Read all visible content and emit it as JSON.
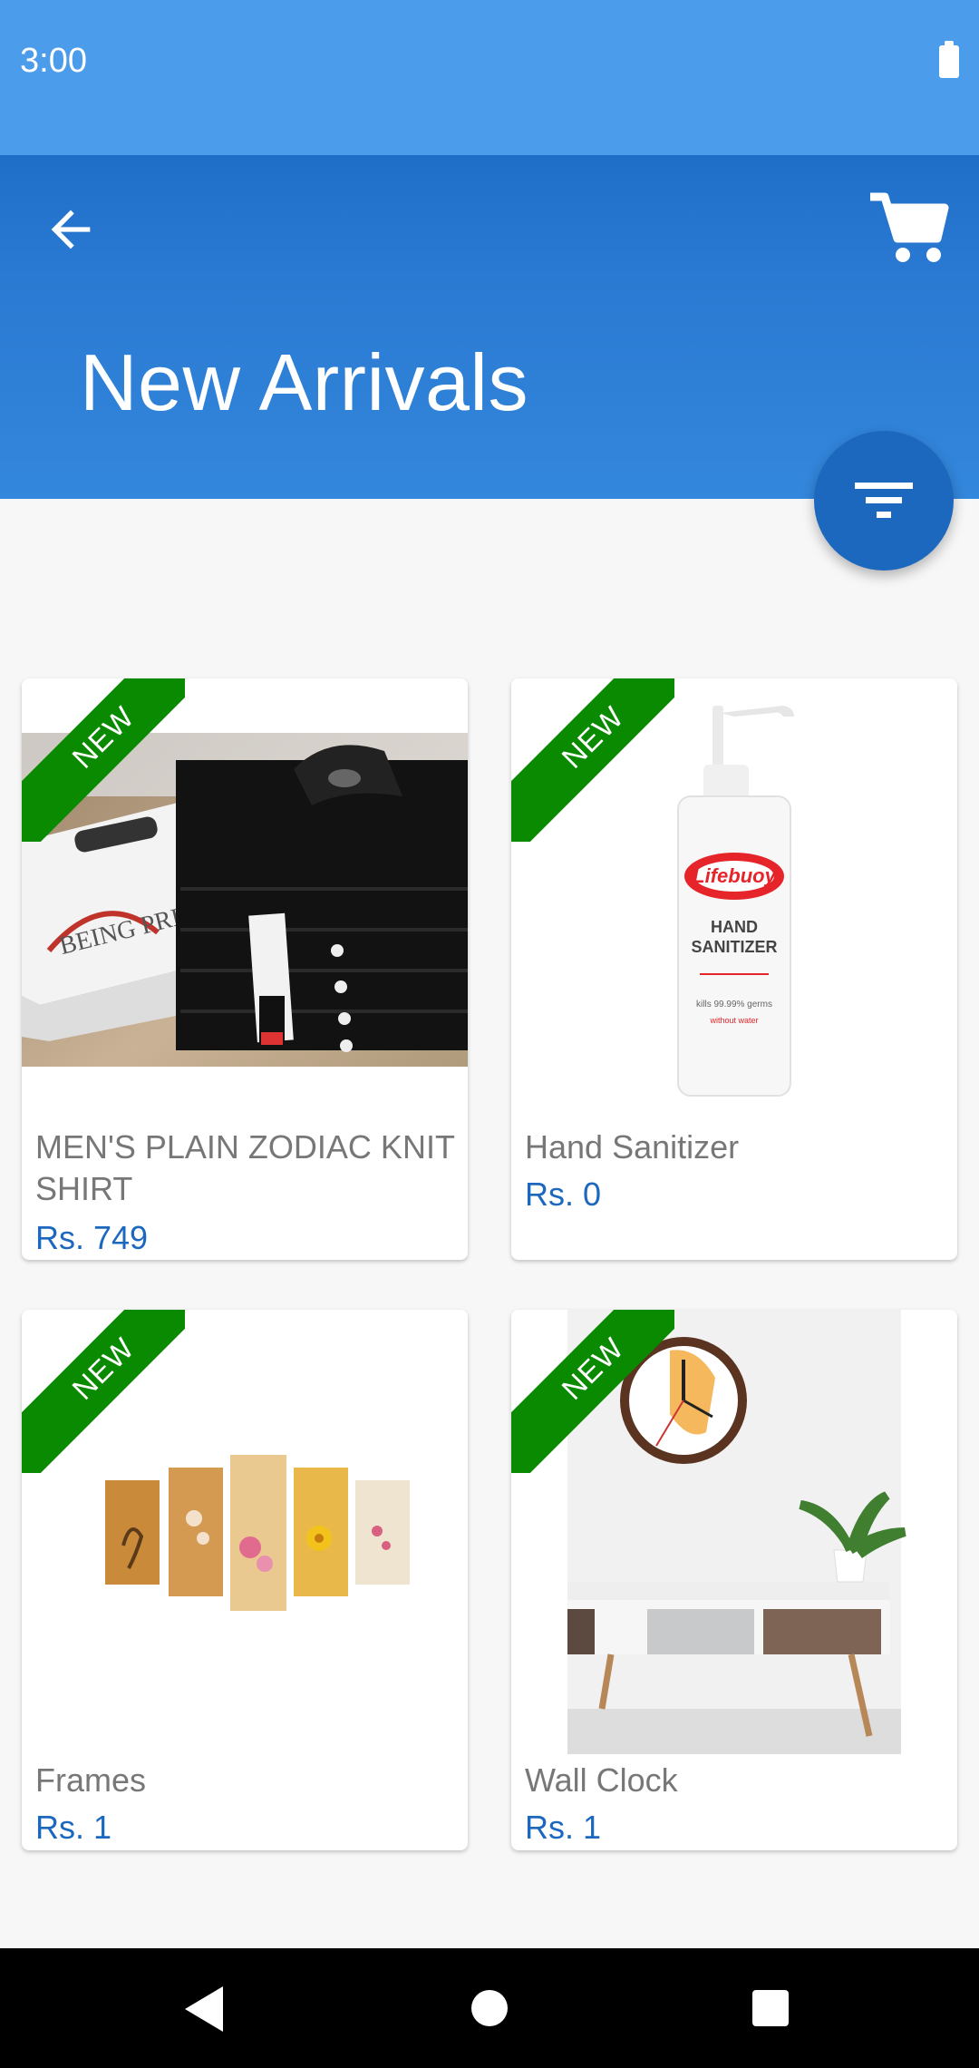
{
  "status_bar": {
    "time": "3:00"
  },
  "header": {
    "title": "New Arrivals"
  },
  "badge_label": "NEW",
  "products": [
    {
      "name": "MEN'S PLAIN ZODIAC KNIT SHIRT",
      "price": "Rs. 749"
    },
    {
      "name": "Hand Sanitizer",
      "price": "Rs. 0"
    },
    {
      "name": "Frames",
      "price": "Rs. 1"
    },
    {
      "name": "Wall Clock",
      "price": "Rs. 1"
    }
  ],
  "sanitizer_label": {
    "brand": "Lifebuoy",
    "line1": "HAND",
    "line2": "SANITIZER",
    "line3": "kills 99.99% germs",
    "line4": "without water"
  },
  "colors": {
    "status_bar": "#4b9deb",
    "app_bar": "#2a79d2",
    "accent": "#1d68bf",
    "badge": "#0a8a00"
  }
}
